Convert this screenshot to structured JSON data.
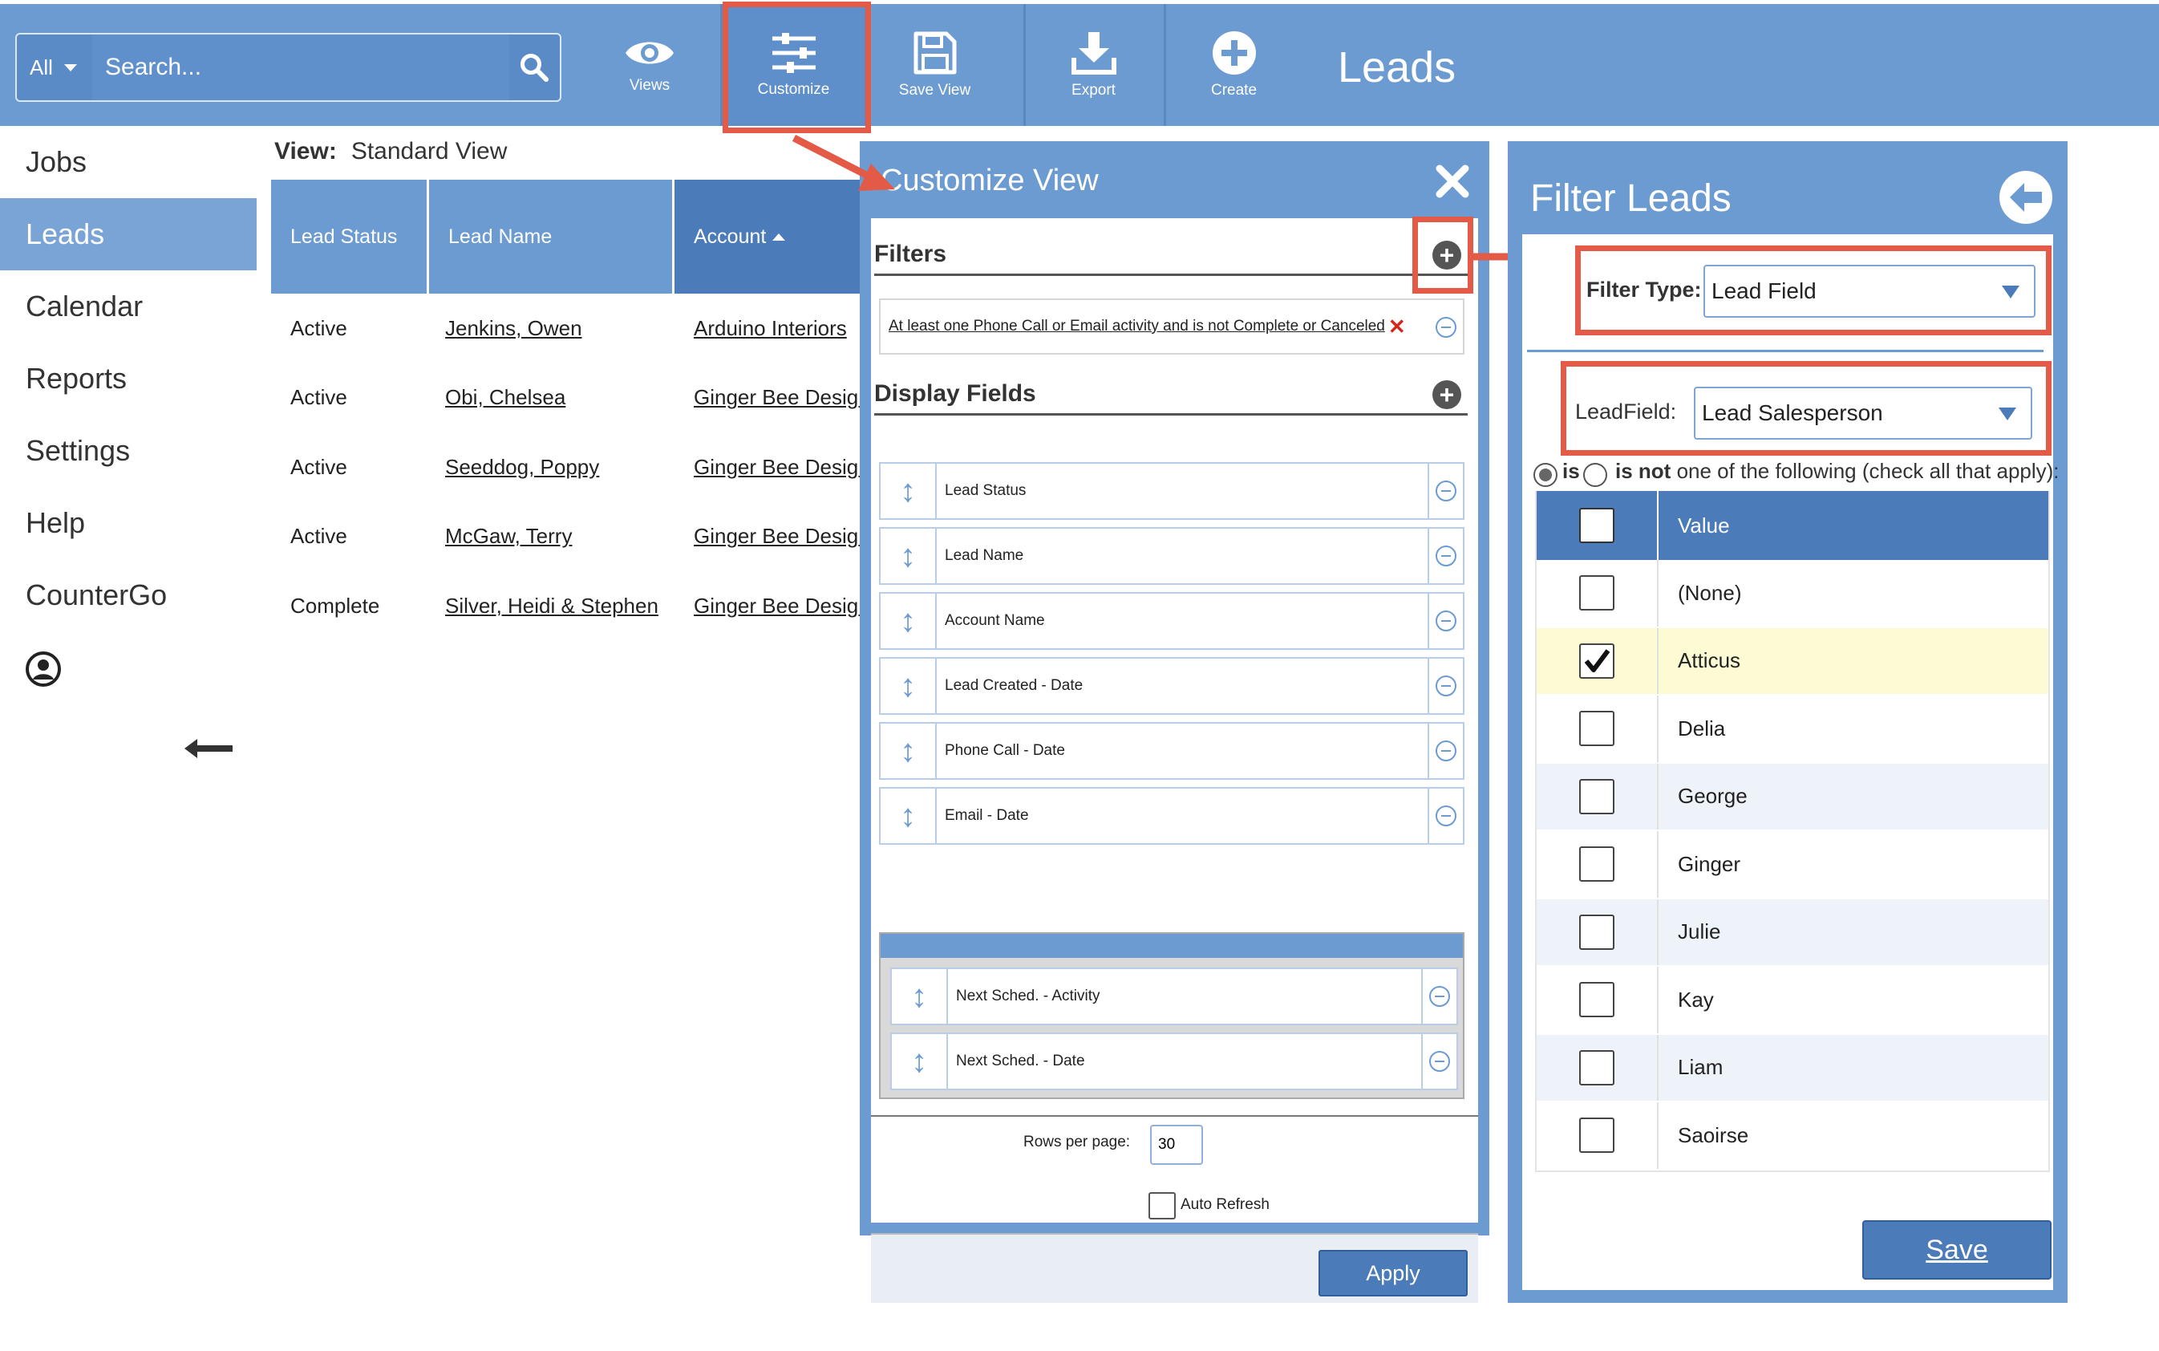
{
  "search": {
    "scope": "All",
    "placeholder": "Search..."
  },
  "toolbar": [
    {
      "label": "Views",
      "icon": "eye-icon"
    },
    {
      "label": "Customize",
      "icon": "sliders-icon"
    },
    {
      "label": "Save View",
      "icon": "floppy-disk-icon"
    },
    {
      "label": "Export",
      "icon": "download-icon"
    },
    {
      "label": "Create",
      "icon": "plus-circle-icon"
    }
  ],
  "page_title": "Leads",
  "sidebar": {
    "items": [
      {
        "label": "Jobs",
        "active": false
      },
      {
        "label": "Leads",
        "active": true
      },
      {
        "label": "Calendar",
        "active": false
      },
      {
        "label": "Reports",
        "active": false
      },
      {
        "label": "Settings",
        "active": false
      },
      {
        "label": "Help",
        "active": false
      },
      {
        "label": "CounterGo",
        "active": false
      }
    ]
  },
  "view": {
    "label": "View:",
    "name": "Standard View"
  },
  "leads_table": {
    "columns": [
      "Lead Status",
      "Lead Name",
      "Account"
    ],
    "sorted_column": "Account",
    "rows": [
      [
        "Active",
        "Jenkins, Owen",
        "Arduino Interiors"
      ],
      [
        "Active",
        "Obi, Chelsea",
        "Ginger Bee Design"
      ],
      [
        "Active",
        "Seeddog, Poppy",
        "Ginger Bee Design"
      ],
      [
        "Active",
        "McGaw, Terry",
        "Ginger Bee Design"
      ],
      [
        "Complete",
        "Silver, Heidi & Stephen",
        "Ginger Bee Design"
      ]
    ]
  },
  "customize": {
    "title": "Customize View",
    "filters_heading": "Filters",
    "filter_rule": "At least one Phone Call or Email activity and is not Complete or Canceled",
    "display_heading": "Display Fields",
    "fields": [
      "Lead Status",
      "Lead Name",
      "Account Name",
      "Lead Created - Date",
      "Phone Call - Date",
      "Email - Date"
    ],
    "group_fields": [
      "Next Sched. - Activity",
      "Next Sched. - Date"
    ],
    "rows_per_page_label": "Rows per page:",
    "rows_per_page": "30",
    "auto_refresh_label": "Auto Refresh",
    "apply_label": "Apply"
  },
  "filter_leads": {
    "title": "Filter Leads",
    "filter_type_label": "Filter Type:",
    "filter_type": "Lead Field",
    "lead_field_label": "LeadField:",
    "lead_field": "Lead Salesperson",
    "is_label": "is",
    "is_not_label": "is not",
    "is_suffix": "one of the following (check all that apply):",
    "value_header": "Value",
    "values": [
      {
        "label": "(None)",
        "checked": false
      },
      {
        "label": "Atticus",
        "checked": true
      },
      {
        "label": "Delia",
        "checked": false
      },
      {
        "label": "George",
        "checked": false
      },
      {
        "label": "Ginger",
        "checked": false
      },
      {
        "label": "Julie",
        "checked": false
      },
      {
        "label": "Kay",
        "checked": false
      },
      {
        "label": "Liam",
        "checked": false
      },
      {
        "label": "Saoirse",
        "checked": false
      }
    ],
    "save_label": "Save"
  },
  "colors": {
    "brand": "#6c9bd2",
    "brand_dark": "#4b7bb8",
    "highlight": "#e35a46",
    "checked_row": "#fdfbd3"
  }
}
